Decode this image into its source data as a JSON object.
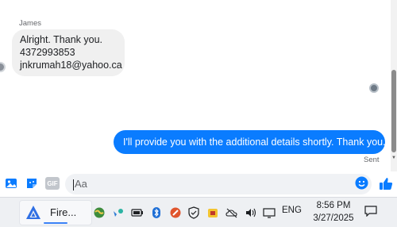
{
  "conversation": {
    "sender_name": "James",
    "incoming_lines": [
      "Alright. Thank you.",
      "4372993853",
      "jnkrumah18@yahoo.ca"
    ],
    "outgoing_message": "I'll provide you with the additional details shortly. Thank you.",
    "status": "Sent"
  },
  "composer": {
    "placeholder": "Aa",
    "icons": [
      "image-icon",
      "sticker-icon",
      "gif-icon",
      "emoji-icon",
      "like-icon"
    ],
    "gif_label": "GIF"
  },
  "taskbar": {
    "app_label": "Fire...",
    "language": "ENG",
    "time": "8:56 PM",
    "date": "3/27/2025",
    "tray_icons": [
      "network-globe-icon",
      "location-icon",
      "battery-icon",
      "bluetooth-icon",
      "tool-icon",
      "shield-icon",
      "security-icon",
      "onedrive-icon",
      "volume-icon",
      "display-icon",
      "camera-icon"
    ]
  },
  "colors": {
    "accent": "#0a7cff",
    "bubble_in": "#f0f0f0",
    "taskbar": "#eef0f3"
  }
}
